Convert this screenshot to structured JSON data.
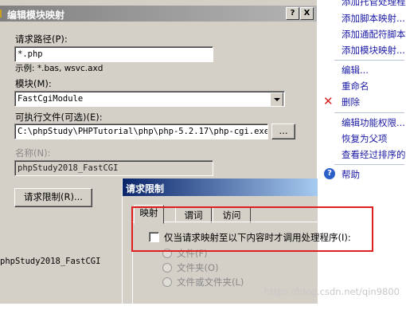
{
  "actions": {
    "items": [
      {
        "label": "添加托管处理程..."
      },
      {
        "label": "添加脚本映射..."
      },
      {
        "label": "添加通配符脚本..."
      },
      {
        "label": "添加模块映射..."
      },
      {
        "label": "编辑..."
      },
      {
        "label": "重命名"
      },
      {
        "label": "删除"
      },
      {
        "label": "编辑功能权限..."
      },
      {
        "label": "恢复为父项"
      },
      {
        "label": "查看经过排序的..."
      },
      {
        "label": "帮助"
      }
    ]
  },
  "edit_dialog": {
    "title": "编辑模块映射",
    "help_btn": "?",
    "close_btn": "X",
    "request_path_label": "请求路径(P):",
    "request_path_value": "*.php",
    "example_text": "示例: *.bas, wsvc.axd",
    "module_label": "模块(M):",
    "module_value": "FastCgiModule",
    "executable_label": "可执行文件(可选)(E):",
    "executable_value": "C:\\phpStudy\\PHPTutorial\\php\\php-5.2.17\\php-cgi.exe",
    "browse_btn": "...",
    "name_label": "名称(N):",
    "name_value": "phpStudy2018_FastCGI",
    "restrictions_btn": "请求限制(R)...",
    "partial_name": "phpStudy2018_FastCGI"
  },
  "req_dialog": {
    "title": "请求限制",
    "tabs": [
      "映射",
      "谓词",
      "访问"
    ],
    "checkbox_label": "仅当请求映射至以下内容时才调用处理程序(I):",
    "radios": [
      "文件(F)",
      "文件夹(O)",
      "文件或文件夹(L)"
    ]
  },
  "watermark": "https://blog.csdn.net/qin9800"
}
